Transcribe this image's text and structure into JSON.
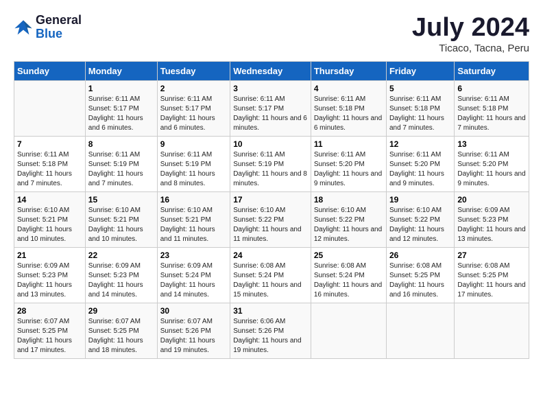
{
  "logo": {
    "general": "General",
    "blue": "Blue"
  },
  "header": {
    "month": "July 2024",
    "location": "Ticaco, Tacna, Peru"
  },
  "weekdays": [
    "Sunday",
    "Monday",
    "Tuesday",
    "Wednesday",
    "Thursday",
    "Friday",
    "Saturday"
  ],
  "weeks": [
    [
      {
        "day": "",
        "sunrise": "",
        "sunset": "",
        "daylight": ""
      },
      {
        "day": "1",
        "sunrise": "6:11 AM",
        "sunset": "5:17 PM",
        "daylight": "11 hours and 6 minutes."
      },
      {
        "day": "2",
        "sunrise": "6:11 AM",
        "sunset": "5:17 PM",
        "daylight": "11 hours and 6 minutes."
      },
      {
        "day": "3",
        "sunrise": "6:11 AM",
        "sunset": "5:17 PM",
        "daylight": "11 hours and 6 minutes."
      },
      {
        "day": "4",
        "sunrise": "6:11 AM",
        "sunset": "5:18 PM",
        "daylight": "11 hours and 6 minutes."
      },
      {
        "day": "5",
        "sunrise": "6:11 AM",
        "sunset": "5:18 PM",
        "daylight": "11 hours and 7 minutes."
      },
      {
        "day": "6",
        "sunrise": "6:11 AM",
        "sunset": "5:18 PM",
        "daylight": "11 hours and 7 minutes."
      }
    ],
    [
      {
        "day": "7",
        "sunrise": "6:11 AM",
        "sunset": "5:18 PM",
        "daylight": "11 hours and 7 minutes."
      },
      {
        "day": "8",
        "sunrise": "6:11 AM",
        "sunset": "5:19 PM",
        "daylight": "11 hours and 7 minutes."
      },
      {
        "day": "9",
        "sunrise": "6:11 AM",
        "sunset": "5:19 PM",
        "daylight": "11 hours and 8 minutes."
      },
      {
        "day": "10",
        "sunrise": "6:11 AM",
        "sunset": "5:19 PM",
        "daylight": "11 hours and 8 minutes."
      },
      {
        "day": "11",
        "sunrise": "6:11 AM",
        "sunset": "5:20 PM",
        "daylight": "11 hours and 9 minutes."
      },
      {
        "day": "12",
        "sunrise": "6:11 AM",
        "sunset": "5:20 PM",
        "daylight": "11 hours and 9 minutes."
      },
      {
        "day": "13",
        "sunrise": "6:11 AM",
        "sunset": "5:20 PM",
        "daylight": "11 hours and 9 minutes."
      }
    ],
    [
      {
        "day": "14",
        "sunrise": "6:10 AM",
        "sunset": "5:21 PM",
        "daylight": "11 hours and 10 minutes."
      },
      {
        "day": "15",
        "sunrise": "6:10 AM",
        "sunset": "5:21 PM",
        "daylight": "11 hours and 10 minutes."
      },
      {
        "day": "16",
        "sunrise": "6:10 AM",
        "sunset": "5:21 PM",
        "daylight": "11 hours and 11 minutes."
      },
      {
        "day": "17",
        "sunrise": "6:10 AM",
        "sunset": "5:22 PM",
        "daylight": "11 hours and 11 minutes."
      },
      {
        "day": "18",
        "sunrise": "6:10 AM",
        "sunset": "5:22 PM",
        "daylight": "11 hours and 12 minutes."
      },
      {
        "day": "19",
        "sunrise": "6:10 AM",
        "sunset": "5:22 PM",
        "daylight": "11 hours and 12 minutes."
      },
      {
        "day": "20",
        "sunrise": "6:09 AM",
        "sunset": "5:23 PM",
        "daylight": "11 hours and 13 minutes."
      }
    ],
    [
      {
        "day": "21",
        "sunrise": "6:09 AM",
        "sunset": "5:23 PM",
        "daylight": "11 hours and 13 minutes."
      },
      {
        "day": "22",
        "sunrise": "6:09 AM",
        "sunset": "5:23 PM",
        "daylight": "11 hours and 14 minutes."
      },
      {
        "day": "23",
        "sunrise": "6:09 AM",
        "sunset": "5:24 PM",
        "daylight": "11 hours and 14 minutes."
      },
      {
        "day": "24",
        "sunrise": "6:08 AM",
        "sunset": "5:24 PM",
        "daylight": "11 hours and 15 minutes."
      },
      {
        "day": "25",
        "sunrise": "6:08 AM",
        "sunset": "5:24 PM",
        "daylight": "11 hours and 16 minutes."
      },
      {
        "day": "26",
        "sunrise": "6:08 AM",
        "sunset": "5:25 PM",
        "daylight": "11 hours and 16 minutes."
      },
      {
        "day": "27",
        "sunrise": "6:08 AM",
        "sunset": "5:25 PM",
        "daylight": "11 hours and 17 minutes."
      }
    ],
    [
      {
        "day": "28",
        "sunrise": "6:07 AM",
        "sunset": "5:25 PM",
        "daylight": "11 hours and 17 minutes."
      },
      {
        "day": "29",
        "sunrise": "6:07 AM",
        "sunset": "5:25 PM",
        "daylight": "11 hours and 18 minutes."
      },
      {
        "day": "30",
        "sunrise": "6:07 AM",
        "sunset": "5:26 PM",
        "daylight": "11 hours and 19 minutes."
      },
      {
        "day": "31",
        "sunrise": "6:06 AM",
        "sunset": "5:26 PM",
        "daylight": "11 hours and 19 minutes."
      },
      {
        "day": "",
        "sunrise": "",
        "sunset": "",
        "daylight": ""
      },
      {
        "day": "",
        "sunrise": "",
        "sunset": "",
        "daylight": ""
      },
      {
        "day": "",
        "sunrise": "",
        "sunset": "",
        "daylight": ""
      }
    ]
  ]
}
